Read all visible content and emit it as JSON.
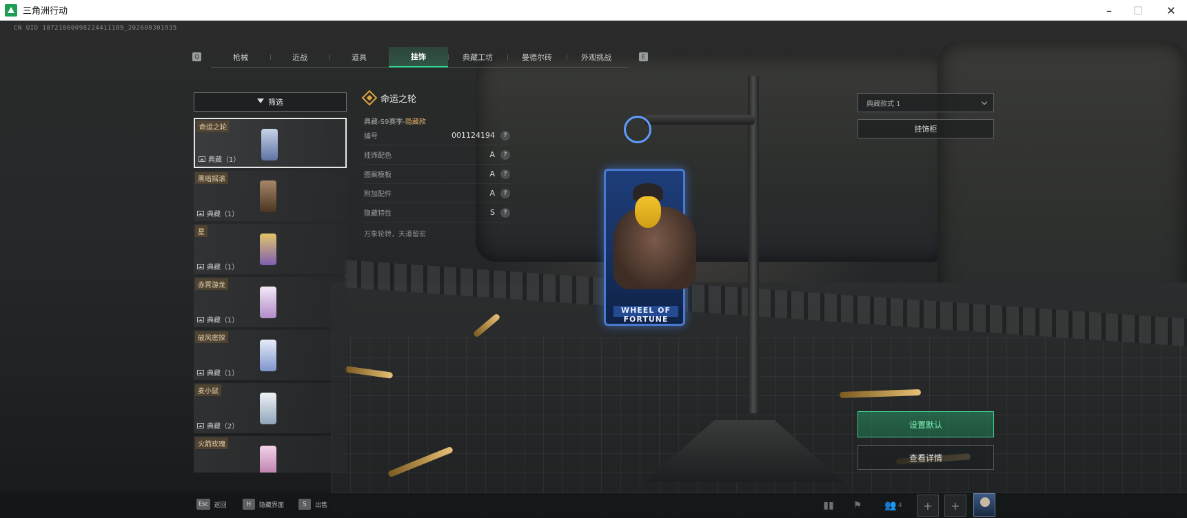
{
  "window": {
    "title": "三角洲行动"
  },
  "uid": "CN UID 18721060098224411189_202608301935",
  "tabs": {
    "left_key": "Q",
    "right_key": "E",
    "items": [
      {
        "label": "枪械"
      },
      {
        "label": "近战"
      },
      {
        "label": "道具"
      },
      {
        "label": "挂饰",
        "active": true
      },
      {
        "label": "典藏工坊"
      },
      {
        "label": "曼德尔砖"
      },
      {
        "label": "外观挑战"
      }
    ]
  },
  "filter": {
    "label": "筛选"
  },
  "list": {
    "items": [
      {
        "name": "命运之轮",
        "tag": "典藏（1）",
        "selected": true,
        "thumb_color": "#7b8fb9"
      },
      {
        "name": "黑暗摇滚",
        "tag": "典藏（1）",
        "thumb_color": "#7b5a3a"
      },
      {
        "name": "星",
        "tag": "典藏（1）",
        "thumb_color": "#a98ad6"
      },
      {
        "name": "赤霄游龙",
        "tag": "典藏（1）",
        "thumb_color": "#d7c3e8"
      },
      {
        "name": "破风密探",
        "tag": "典藏（1）",
        "thumb_color": "#9cb0e0"
      },
      {
        "name": "麦小鼠",
        "tag": "典藏（2）",
        "thumb_color": "#c8d4e0"
      },
      {
        "name": "火箭玫瑰",
        "tag": "",
        "thumb_color": "#d9a0c8"
      }
    ]
  },
  "detail": {
    "title": "命运之轮",
    "sub_prefix": "典藏-S9赛季-",
    "sub_highlight": "隐藏款",
    "attributes": [
      {
        "label": "编号",
        "value": "001124194"
      },
      {
        "label": "挂饰配色",
        "value": "A"
      },
      {
        "label": "图案模板",
        "value": "A"
      },
      {
        "label": "附加配件",
        "value": "A"
      },
      {
        "label": "隐藏特性",
        "value": "S"
      }
    ],
    "help_glyph": "?",
    "footer": "万象轮转，天道留宏"
  },
  "charm": {
    "banner": "WHEEL OF FORTUNE"
  },
  "controls": {
    "style_select": "典藏款式 1",
    "cabinet": "挂饰柜",
    "set_default": "设置默认",
    "view_details": "查看详情"
  },
  "bottom": {
    "hints": [
      {
        "key": "Esc",
        "label": "返回"
      },
      {
        "key": "H",
        "label": "隐藏界面"
      },
      {
        "key": "S",
        "label": "出售"
      }
    ],
    "friends_count": "4",
    "slot_plus": "+"
  },
  "colors": {
    "accent_green": "#35d38f",
    "tag_gold": "#e0b066",
    "card_blue": "#4a7ad0"
  }
}
